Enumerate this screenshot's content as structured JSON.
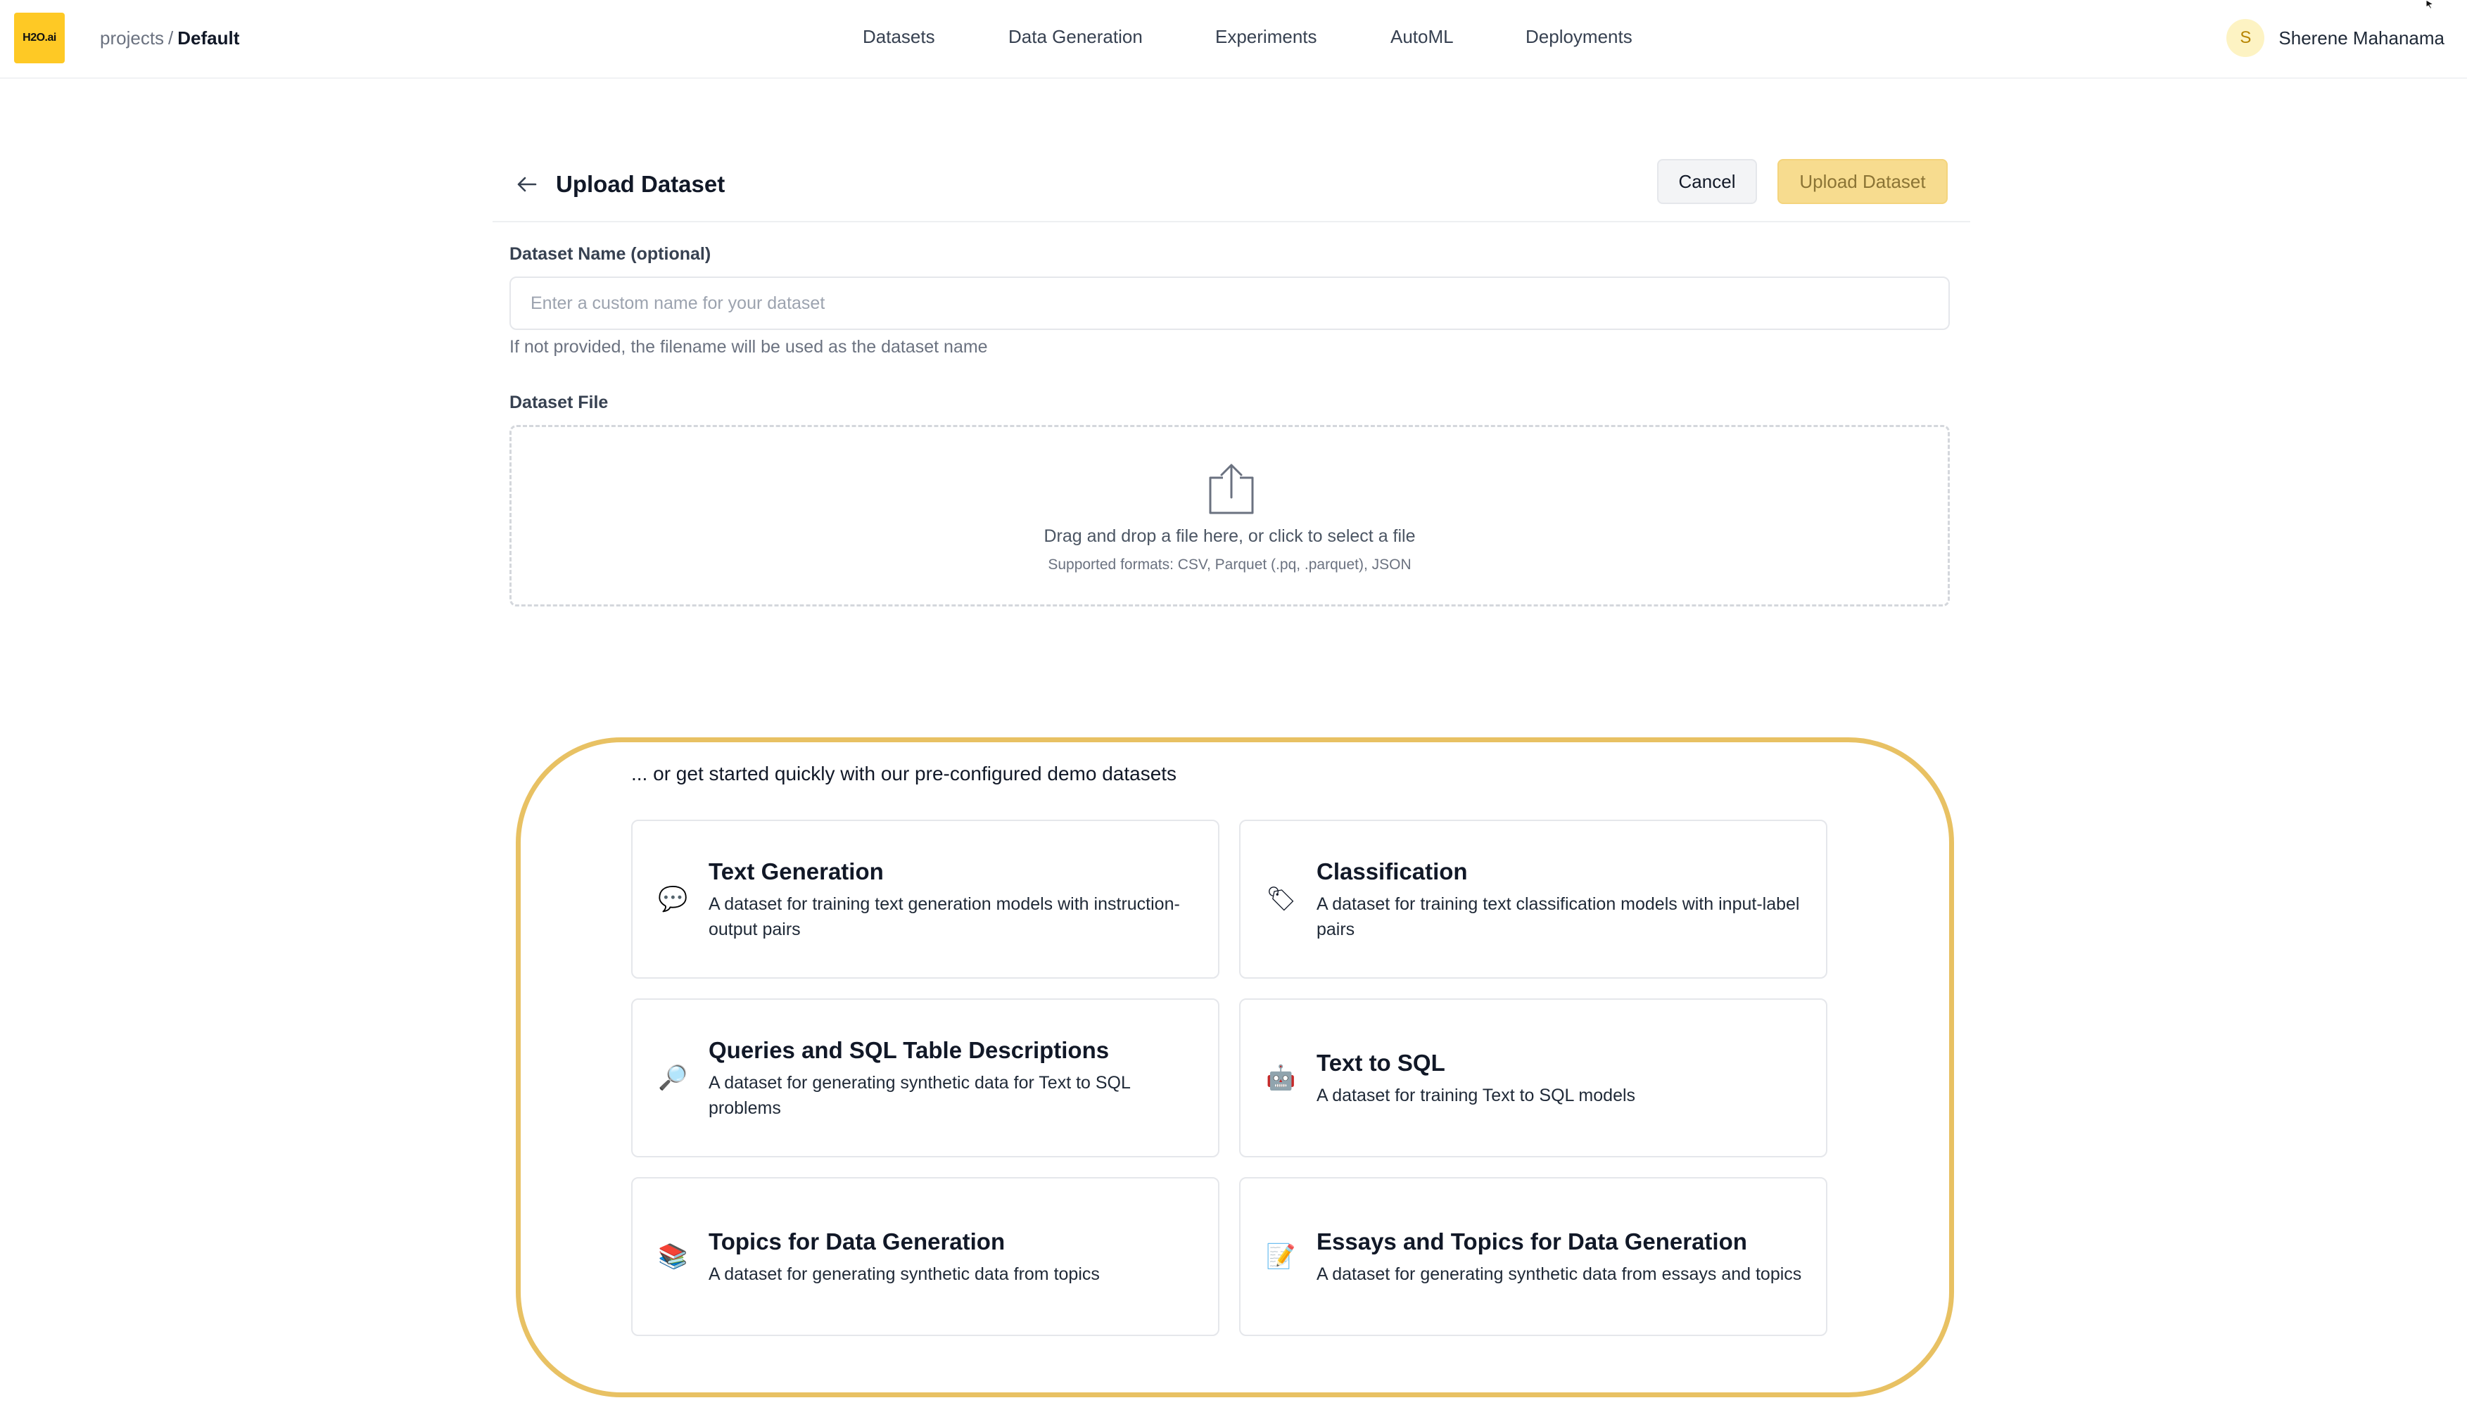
{
  "header": {
    "logo_text": "H2O.ai",
    "breadcrumb": {
      "parent": "projects",
      "separator": "/",
      "current": "Default"
    },
    "nav": [
      {
        "label": "Datasets"
      },
      {
        "label": "Data Generation"
      },
      {
        "label": "Experiments"
      },
      {
        "label": "AutoML"
      },
      {
        "label": "Deployments"
      }
    ],
    "user": {
      "initial": "S",
      "name": "Sherene Mahanama"
    }
  },
  "page": {
    "title": "Upload Dataset",
    "cancel_label": "Cancel",
    "upload_label": "Upload Dataset"
  },
  "form": {
    "name_label": "Dataset Name (optional)",
    "name_placeholder": "Enter a custom name for your dataset",
    "name_value": "",
    "name_help": "If not provided, the filename will be used as the dataset name",
    "file_label": "Dataset File",
    "dropzone_text": "Drag and drop a file here, or click to select a file",
    "dropzone_formats": "Supported formats: CSV, Parquet (.pq, .parquet), JSON"
  },
  "demo": {
    "intro": "... or get started quickly with our pre-configured demo datasets",
    "cards": [
      {
        "icon": "speech-bubble-icon",
        "emoji": "💬",
        "title": "Text Generation",
        "description": "A dataset for training text generation models with instruction-output pairs"
      },
      {
        "icon": "label-tag-icon",
        "emoji": "🏷",
        "title": "Classification",
        "description": "A dataset for training text classification models with input-label pairs"
      },
      {
        "icon": "magnifying-glass-icon",
        "emoji": "🔎",
        "title": "Queries and SQL Table Descriptions",
        "description": "A dataset for generating synthetic data for Text to SQL problems"
      },
      {
        "icon": "robot-icon",
        "emoji": "🤖",
        "title": "Text to SQL",
        "description": "A dataset for training Text to SQL models"
      },
      {
        "icon": "books-icon",
        "emoji": "📚",
        "title": "Topics for Data Generation",
        "description": "A dataset for generating synthetic data from topics"
      },
      {
        "icon": "memo-icon",
        "emoji": "📝",
        "title": "Essays and Topics for Data Generation",
        "description": "A dataset for generating synthetic data from essays and topics"
      }
    ]
  },
  "colors": {
    "brand_yellow": "#fec925",
    "panel_border": "#e8c163",
    "upload_button_bg": "#f7dc8f"
  }
}
